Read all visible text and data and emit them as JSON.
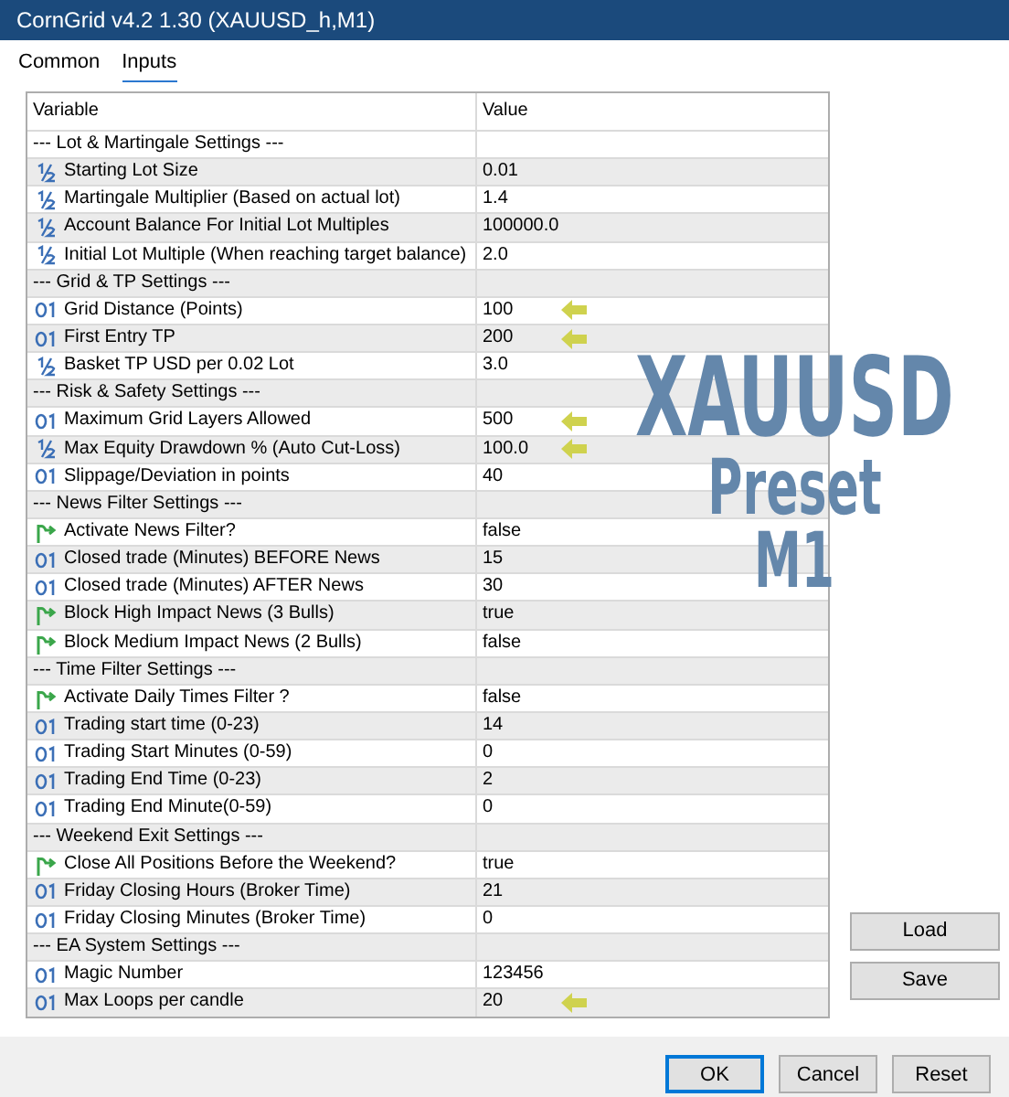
{
  "window": {
    "title": "CornGrid v4.2 1.30 (XAUUSD_h,M1)"
  },
  "tabs": [
    {
      "label": "Common",
      "selected": false
    },
    {
      "label": "Inputs",
      "selected": true
    }
  ],
  "table": {
    "columns": [
      "Variable",
      "Value"
    ],
    "sections": [
      {
        "title": "--- Lot & Martingale Settings ---",
        "params": [
          {
            "kind": "double",
            "name": "Starting Lot Size",
            "value": "0.01",
            "marked": false
          },
          {
            "kind": "double",
            "name": "Martingale Multiplier (Based on actual lot)",
            "value": "1.4",
            "marked": false
          },
          {
            "kind": "double",
            "name": "Account Balance For Initial Lot Multiples",
            "value": "100000.0",
            "marked": false
          },
          {
            "kind": "double",
            "name": "Initial Lot Multiple (When reaching target balance)",
            "value": "2.0",
            "marked": false
          }
        ]
      },
      {
        "title": "--- Grid & TP Settings ---",
        "params": [
          {
            "kind": "int",
            "name": "Grid Distance (Points)",
            "value": "100",
            "marked": true
          },
          {
            "kind": "int",
            "name": "First Entry TP",
            "value": "200",
            "marked": true
          },
          {
            "kind": "double",
            "name": "Basket TP USD per 0.02 Lot",
            "value": "3.0",
            "marked": false
          }
        ]
      },
      {
        "title": "--- Risk & Safety Settings ---",
        "params": [
          {
            "kind": "int",
            "name": "Maximum Grid Layers Allowed",
            "value": "500",
            "marked": true
          },
          {
            "kind": "double",
            "name": "Max Equity Drawdown % (Auto Cut-Loss)",
            "value": "100.0",
            "marked": true
          },
          {
            "kind": "int",
            "name": "Slippage/Deviation in points",
            "value": "40",
            "marked": false
          }
        ]
      },
      {
        "title": "--- News Filter Settings ---",
        "params": [
          {
            "kind": "bool",
            "name": "Activate News Filter?",
            "value": "false",
            "marked": false
          },
          {
            "kind": "int",
            "name": "Closed trade (Minutes) BEFORE News",
            "value": "15",
            "marked": false
          },
          {
            "kind": "int",
            "name": "Closed trade (Minutes) AFTER News",
            "value": "30",
            "marked": false
          },
          {
            "kind": "bool",
            "name": "Block High Impact News (3 Bulls)",
            "value": "true",
            "marked": false
          },
          {
            "kind": "bool",
            "name": "Block Medium Impact News (2 Bulls)",
            "value": "false",
            "marked": false
          }
        ]
      },
      {
        "title": "--- Time Filter Settings ---",
        "params": [
          {
            "kind": "bool",
            "name": "Activate Daily Times Filter ?",
            "value": "false",
            "marked": false
          },
          {
            "kind": "int",
            "name": "Trading start time (0-23)",
            "value": "14",
            "marked": false
          },
          {
            "kind": "int",
            "name": "Trading Start Minutes (0-59)",
            "value": "0",
            "marked": false
          },
          {
            "kind": "int",
            "name": "Trading End Time (0-23)",
            "value": "2",
            "marked": false
          },
          {
            "kind": "int",
            "name": "Trading End Minute(0-59)",
            "value": "0",
            "marked": false
          }
        ]
      },
      {
        "title": "--- Weekend Exit Settings ---",
        "params": [
          {
            "kind": "bool",
            "name": "Close All Positions Before the Weekend?",
            "value": "true",
            "marked": false
          },
          {
            "kind": "int",
            "name": "Friday Closing Hours (Broker Time)",
            "value": "21",
            "marked": false
          },
          {
            "kind": "int",
            "name": "Friday Closing Minutes (Broker Time)",
            "value": "0",
            "marked": false
          }
        ]
      },
      {
        "title": "--- EA System Settings ---",
        "params": [
          {
            "kind": "int",
            "name": "Magic Number",
            "value": "123456",
            "marked": false
          },
          {
            "kind": "int",
            "name": "Max Loops per candle",
            "value": "20",
            "marked": true
          }
        ]
      }
    ]
  },
  "overlay": [
    "XAUUSD",
    "Preset",
    "M1"
  ],
  "side_buttons": [
    "Load",
    "Save"
  ],
  "buttons": [
    {
      "label": "OK",
      "default": true
    },
    {
      "label": "Cancel",
      "default": false
    },
    {
      "label": "Reset",
      "default": false
    }
  ]
}
